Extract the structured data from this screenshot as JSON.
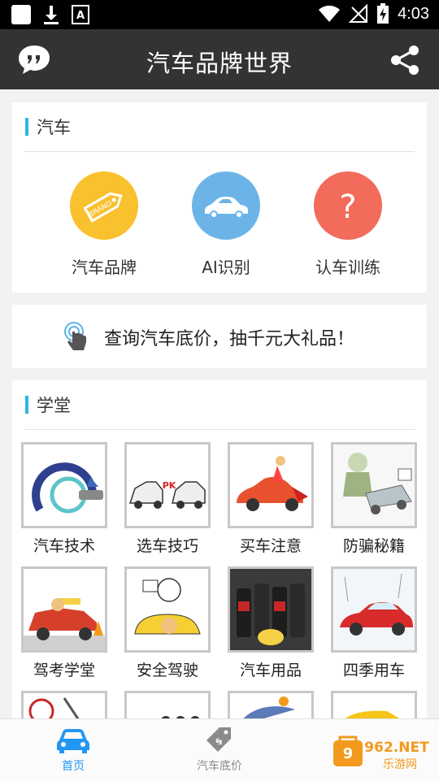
{
  "status_bar": {
    "time": "4:03"
  },
  "app_bar": {
    "title": "汽车品牌世界"
  },
  "car_section": {
    "title": "汽车",
    "features": [
      {
        "label": "汽车品牌",
        "color": "#f9c12e",
        "icon": "brand-tag-icon"
      },
      {
        "label": "AI识别",
        "color": "#6cb4e8",
        "icon": "car-icon"
      },
      {
        "label": "认车训练",
        "color": "#f26b5b",
        "icon": "question-icon"
      }
    ]
  },
  "promo": {
    "text": "查询汽车底价，抽千元大礼品！"
  },
  "school_section": {
    "title": "学堂",
    "items": [
      {
        "label": "汽车技术"
      },
      {
        "label": "选车技巧"
      },
      {
        "label": "买车注意"
      },
      {
        "label": "防骗秘籍"
      },
      {
        "label": "驾考学堂"
      },
      {
        "label": "安全驾驶"
      },
      {
        "label": "汽车用品"
      },
      {
        "label": "四季用车"
      }
    ]
  },
  "tab_bar": {
    "tabs": [
      {
        "label": "首页",
        "active": true
      },
      {
        "label": "汽车底价",
        "active": false
      }
    ],
    "active_color": "#2196f3",
    "inactive_color": "#8a8a8a"
  },
  "watermark": {
    "brand": "962.NET",
    "sub": "乐游网"
  }
}
